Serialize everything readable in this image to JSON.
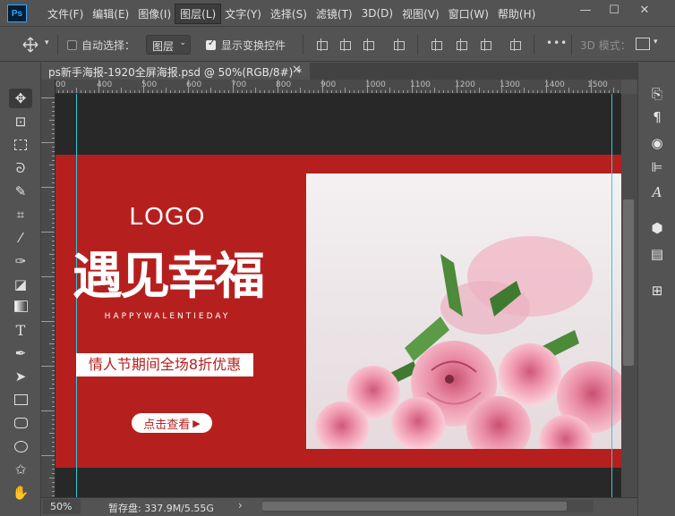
{
  "app": {
    "logo_label": "Ps"
  },
  "menu": {
    "items": [
      "文件(F)",
      "编辑(E)",
      "图像(I)",
      "图层(L)",
      "文字(Y)",
      "选择(S)",
      "滤镜(T)",
      "3D(D)",
      "视图(V)",
      "窗口(W)",
      "帮助(H)"
    ],
    "active_index": 3
  },
  "window_controls": {
    "minimize": "—",
    "restore": "☐",
    "close": "✕"
  },
  "options_bar": {
    "auto_select_label": "自动选择：",
    "auto_select_checked": false,
    "auto_select_target": "图层",
    "show_transform_label": "显示变换控件",
    "show_transform_checked": true,
    "more_label": "•••",
    "mode_3d_label": "3D 模式："
  },
  "document": {
    "tab_title": "ps新手海报-1920全屏海报.psd @ 50%(RGB/8#) *",
    "close_label": "✕"
  },
  "ruler": {
    "top_labels": [
      "00",
      "400",
      "500",
      "600",
      "700",
      "800",
      "900",
      "1000",
      "1100",
      "1200",
      "1300",
      "1400",
      "1500"
    ]
  },
  "poster": {
    "logo": "LOGO",
    "headline": "遇见幸福",
    "subtitle_en": "HAPPYWALENTIEDAY",
    "promo": "情人节期间全场8折优惠",
    "cta": "点击查看",
    "cta_arrow": "▶",
    "colors": {
      "red": "#b5201f",
      "dark": "#282828",
      "guide": "#33c9d6"
    }
  },
  "status": {
    "zoom": "50%",
    "doc_info": "暂存盘: 337.9M/5.55G",
    "arrow": "›"
  },
  "tools": [
    "move-tool",
    "artboard-tool",
    "marquee-tool",
    "lasso-tool",
    "quick-select-tool",
    "crop-tool",
    "eyedropper-tool",
    "brush-tool",
    "eraser-tool",
    "gradient-tool",
    "type-tool",
    "pen-tool",
    "path-select-tool",
    "rectangle-tool",
    "rounded-rect-tool",
    "ellipse-tool",
    "custom-shape-tool",
    "hand-tool"
  ],
  "right_panel_icons": [
    "history-icon",
    "paragraph-icon",
    "swatches-icon",
    "properties-icon",
    "glyphs-icon",
    "3d-icon",
    "layer-comps-icon",
    "grid-icon"
  ]
}
